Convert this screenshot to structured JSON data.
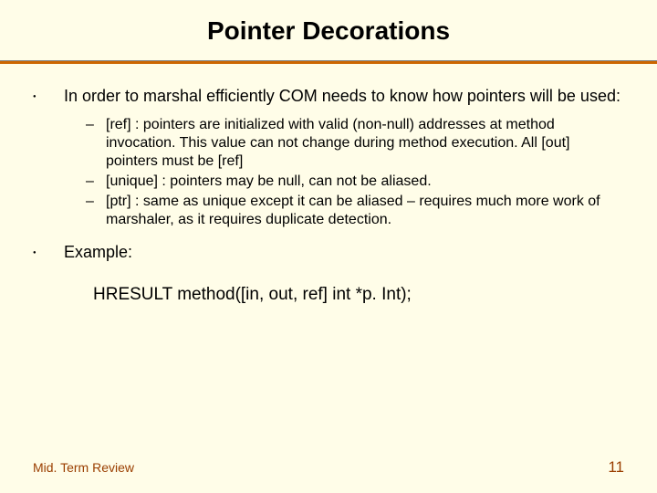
{
  "title": "Pointer Decorations",
  "bullets": [
    {
      "text": "In order to marshal efficiently COM needs to know how pointers will be used:",
      "sub": [
        "[ref] : pointers are initialized with valid (non-null) addresses at method invocation.  This value can not change during method execution.  All [out] pointers must be [ref]",
        "[unique] : pointers may be null, can not be aliased.",
        "[ptr] : same as unique except it can be aliased – requires much more work of marshaler, as it requires duplicate detection."
      ]
    },
    {
      "text": "Example:",
      "sub": []
    }
  ],
  "example_code": "HRESULT method([in, out, ref] int *p. Int);",
  "footer": {
    "left": "Mid. Term Review",
    "page": "11"
  }
}
